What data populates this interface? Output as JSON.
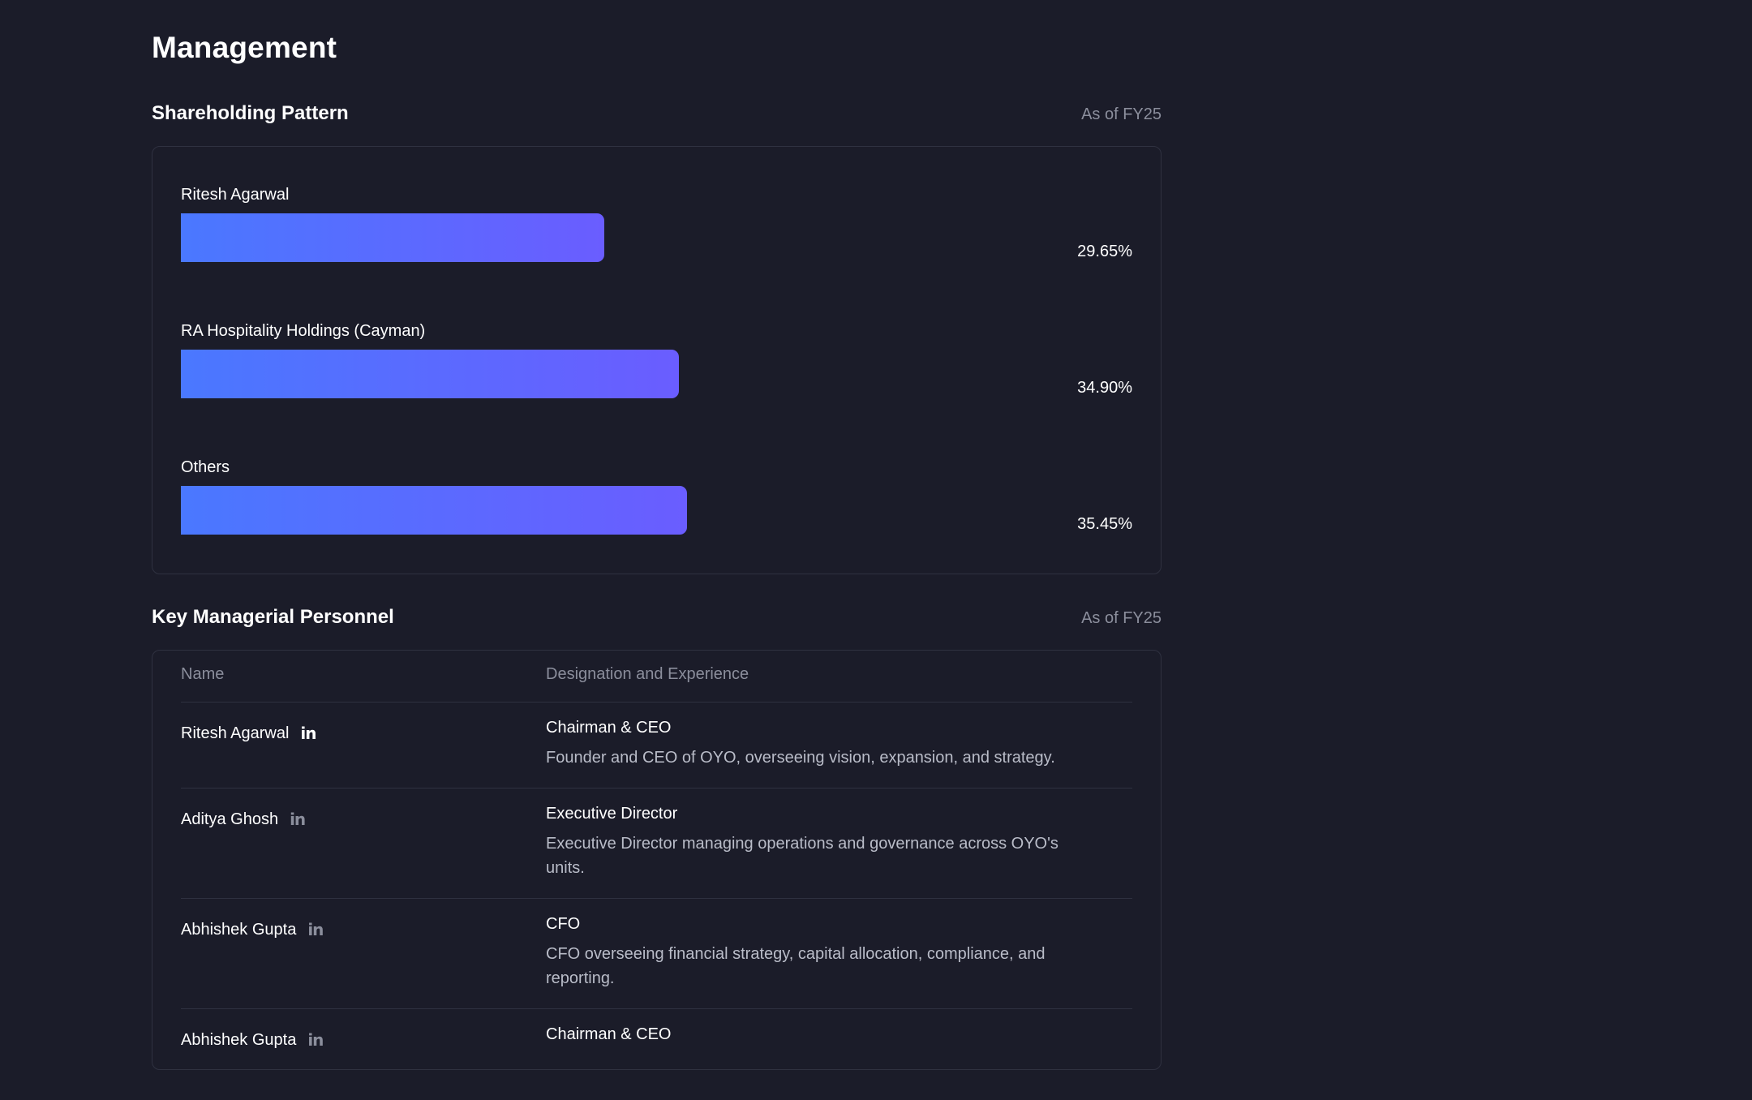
{
  "page": {
    "title": "Management"
  },
  "shareholding": {
    "title": "Shareholding Pattern",
    "as_of": "As of FY25",
    "items": [
      {
        "name": "Ritesh Agarwal",
        "value_label": "29.65%",
        "percent": 29.65
      },
      {
        "name": "RA Hospitality Holdings (Cayman)",
        "value_label": "34.90%",
        "percent": 34.9
      },
      {
        "name": "Others",
        "value_label": "35.45%",
        "percent": 35.45
      }
    ]
  },
  "personnel": {
    "title": "Key Managerial Personnel",
    "as_of": "As of FY25",
    "columns": {
      "name": "Name",
      "designation": "Designation and Experience"
    },
    "rows": [
      {
        "name": "Ritesh Agarwal",
        "linkedin_icon": "linkedin-icon",
        "designation": "Chairman & CEO",
        "description": "Founder and CEO of OYO, overseeing vision, expansion, and strategy."
      },
      {
        "name": "Aditya Ghosh",
        "linkedin_icon": "linkedin-icon",
        "designation": "Executive Director",
        "description": "Executive Director managing operations and governance across OYO's units."
      },
      {
        "name": "Abhishek Gupta",
        "linkedin_icon": "linkedin-icon",
        "designation": "CFO",
        "description": "CFO overseeing financial strategy, capital allocation, compliance, and reporting."
      },
      {
        "name": "Abhishek Gupta",
        "linkedin_icon": "linkedin-icon",
        "designation": "Chairman & CEO",
        "description": ""
      }
    ]
  },
  "colors": {
    "background": "#1b1c29",
    "bar_start": "#4a78ff",
    "bar_end": "#6a5dff",
    "muted_text": "#8b8e9c",
    "border": "#2f3140"
  }
}
